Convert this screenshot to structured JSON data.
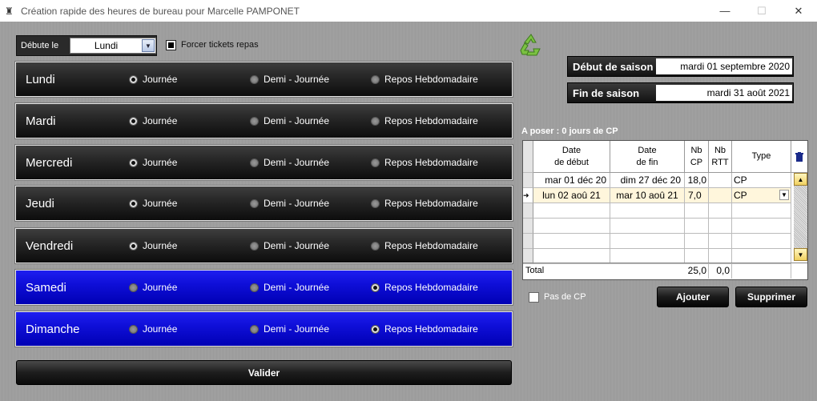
{
  "window": {
    "title": "Création rapide des heures de bureau pour Marcelle PAMPONET",
    "minimize": "—",
    "maximize": "☐",
    "close": "✕"
  },
  "start": {
    "label": "Débute le",
    "value": "Lundi"
  },
  "force_tickets": {
    "label": "Forcer tickets repas",
    "checked": true
  },
  "radio_labels": {
    "full": "Journée",
    "half": "Demi - Journée",
    "rest": "Repos Hebdomadaire"
  },
  "days": [
    {
      "name": "Lundi",
      "selected": "full",
      "weekend": false
    },
    {
      "name": "Mardi",
      "selected": "full",
      "weekend": false
    },
    {
      "name": "Mercredi",
      "selected": "full",
      "weekend": false
    },
    {
      "name": "Jeudi",
      "selected": "full",
      "weekend": false
    },
    {
      "name": "Vendredi",
      "selected": "full",
      "weekend": false
    },
    {
      "name": "Samedi",
      "selected": "rest",
      "weekend": true
    },
    {
      "name": "Dimanche",
      "selected": "rest",
      "weekend": true
    }
  ],
  "valider": "Valider",
  "season": {
    "start_label": "Début de saison",
    "start_value": "mardi 01 septembre 2020",
    "end_label": "Fin de saison",
    "end_value": "mardi 31 août 2021"
  },
  "cp": {
    "a_poser": "A poser : 0 jours de CP",
    "headers": {
      "date_debut": "Date\nde début",
      "date_fin": "Date\nde fin",
      "nb_cp": "Nb\nCP",
      "nb_rtt": "Nb\nRTT",
      "type": "Type"
    },
    "rows": [
      {
        "debut": "mar 01 déc 20",
        "fin": "dim 27 déc 20",
        "cp": "18,0",
        "rtt": "",
        "type": "CP"
      },
      {
        "debut": "lun 02 aoû 21",
        "fin": "mar 10 aoû 21",
        "cp": "7,0",
        "rtt": "",
        "type": "CP"
      }
    ],
    "total_label": "Total",
    "total_cp": "25,0",
    "total_rtt": "0,0"
  },
  "pas_de_cp": "Pas de CP",
  "ajouter": "Ajouter",
  "supprimer": "Supprimer"
}
